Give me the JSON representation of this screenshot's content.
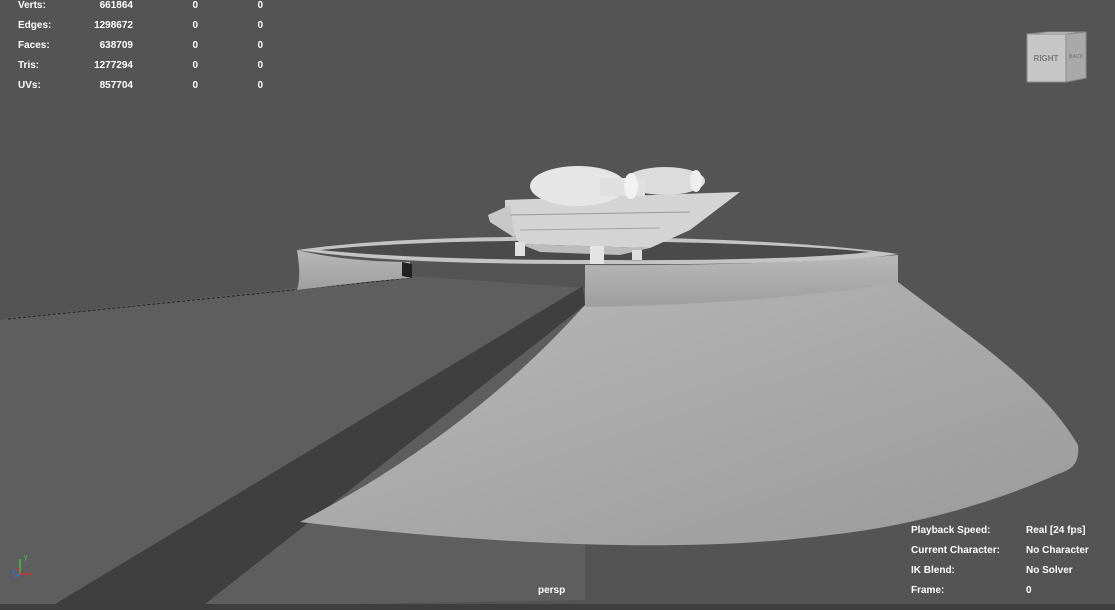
{
  "hud": {
    "poly_count": [
      {
        "label": "Verts:",
        "values": [
          "661864",
          "0",
          "0"
        ]
      },
      {
        "label": "Edges:",
        "values": [
          "1298672",
          "0",
          "0"
        ]
      },
      {
        "label": "Faces:",
        "values": [
          "638709",
          "0",
          "0"
        ]
      },
      {
        "label": "Tris:",
        "values": [
          "1277294",
          "0",
          "0"
        ]
      },
      {
        "label": "UVs:",
        "values": [
          "857704",
          "0",
          "0"
        ]
      }
    ],
    "playback": [
      {
        "label": "Playback Speed:",
        "value": "Real [24 fps]"
      },
      {
        "label": "Current Character:",
        "value": "No Character"
      },
      {
        "label": "IK Blend:",
        "value": "No Solver"
      },
      {
        "label": "Frame:",
        "value": "0"
      }
    ]
  },
  "viewcube": {
    "front_face": "RIGHT",
    "side_face": "BACK"
  },
  "camera": {
    "name": "persp"
  },
  "axis_gizmo": {
    "x": "x",
    "y": "y",
    "z": "z"
  },
  "colors": {
    "background": "#545454",
    "geometry": "#b3b3b3",
    "hud_text": "#ffffff"
  }
}
